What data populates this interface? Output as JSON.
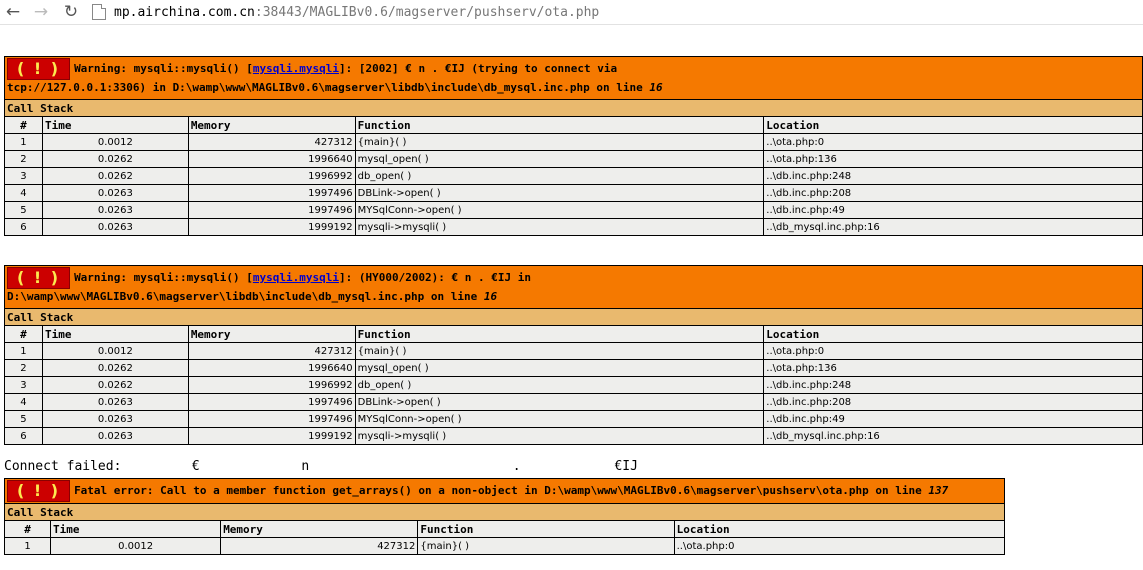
{
  "browser": {
    "url_host": "mp.airchina.com.cn",
    "url_path": ":38443/MAGLIBv0.6/magserver/pushserv/ota.php"
  },
  "blocks": [
    {
      "bang": "( ! )",
      "line1_prefix": "Warning: mysqli::mysqli() [",
      "link": "mysqli.mysqli",
      "line1_rest": "]: [2002]          €                   n                                    .                       €IJ            (trying to connect via",
      "line2": "tcp://127.0.0.1:3306) in D:\\wamp\\www\\MAGLIBv0.6\\magserver\\libdb\\include\\db_mysql.inc.php on line ",
      "line_no": "16",
      "call_stack": "Call Stack",
      "headers": [
        "#",
        "Time",
        "Memory",
        "Function",
        "Location"
      ],
      "rows": [
        [
          "1",
          "0.0012",
          "427312",
          "{main}( )",
          "..\\ota.php:0"
        ],
        [
          "2",
          "0.0262",
          "1996640",
          "mysql_open( )",
          "..\\ota.php:136"
        ],
        [
          "3",
          "0.0262",
          "1996992",
          "db_open( )",
          "..\\db.inc.php:248"
        ],
        [
          "4",
          "0.0263",
          "1997496",
          "DBLink->open( )",
          "..\\db.inc.php:208"
        ],
        [
          "5",
          "0.0263",
          "1997496",
          "MYSqlConn->open( )",
          "..\\db.inc.php:49"
        ],
        [
          "6",
          "0.0263",
          "1999192",
          "mysqli->mysqli( )",
          "..\\db_mysql.inc.php:16"
        ]
      ]
    },
    {
      "bang": "( ! )",
      "line1_prefix": "Warning: mysqli::mysqli() [",
      "link": "mysqli.mysqli",
      "line1_rest": "]: (HY000/2002):          €                   n                                    .                       €IJ            in",
      "line2": "D:\\wamp\\www\\MAGLIBv0.6\\magserver\\libdb\\include\\db_mysql.inc.php on line ",
      "line_no": "16",
      "call_stack": "Call Stack",
      "headers": [
        "#",
        "Time",
        "Memory",
        "Function",
        "Location"
      ],
      "rows": [
        [
          "1",
          "0.0012",
          "427312",
          "{main}( )",
          "..\\ota.php:0"
        ],
        [
          "2",
          "0.0262",
          "1996640",
          "mysql_open( )",
          "..\\ota.php:136"
        ],
        [
          "3",
          "0.0262",
          "1996992",
          "db_open( )",
          "..\\db.inc.php:248"
        ],
        [
          "4",
          "0.0263",
          "1997496",
          "DBLink->open( )",
          "..\\db.inc.php:208"
        ],
        [
          "5",
          "0.0263",
          "1997496",
          "MYSqlConn->open( )",
          "..\\db.inc.php:49"
        ],
        [
          "6",
          "0.0263",
          "1999192",
          "mysqli->mysqli( )",
          "..\\db_mysql.inc.php:16"
        ]
      ]
    },
    {
      "bang": "( ! )",
      "line1": "Fatal error: Call to a member function get_arrays() on a non-object in D:\\wamp\\www\\MAGLIBv0.6\\magserver\\pushserv\\ota.php on line ",
      "line_no": "137",
      "call_stack": "Call Stack",
      "headers": [
        "#",
        "Time",
        "Memory",
        "Function",
        "Location"
      ],
      "rows": [
        [
          "1",
          "0.0012",
          "427312",
          "{main}( )",
          "..\\ota.php:0"
        ]
      ]
    }
  ],
  "connect_failed": "Connect failed:         €             n                          .            €IJ"
}
